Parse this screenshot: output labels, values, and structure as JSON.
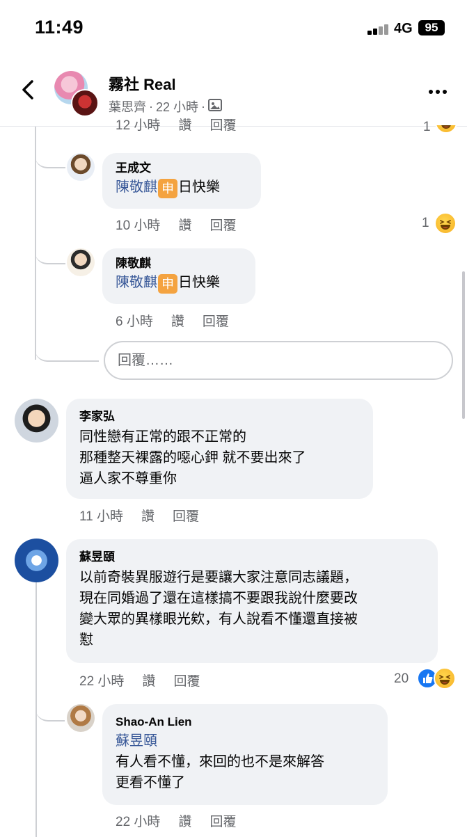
{
  "status_bar": {
    "time": "11:49",
    "network": "4G",
    "battery": "95"
  },
  "header": {
    "page_name": "霧社 Real",
    "author": "葉思齊",
    "separator": "·",
    "age": "22 小時",
    "separator2": "·"
  },
  "comments": [
    {
      "name": "",
      "clipped_actions": [
        "12 小時",
        "讚",
        "回覆"
      ],
      "reactions": "1"
    },
    {
      "name": "王成文",
      "mention": "陳敬麒",
      "badge": "申",
      "text": "日快樂",
      "time": "10 小時",
      "like": "讚",
      "reply": "回覆",
      "reactions": "1"
    },
    {
      "name": "陳敬麒",
      "mention": "陳敬麒",
      "badge": "申",
      "text": "日快樂",
      "time": "6 小時",
      "like": "讚",
      "reply": "回覆"
    },
    {
      "name": "李家弘",
      "text": "同性戀有正常的跟不正常的\n那種整天裸露的噁心鉀 就不要出來了\n逼人家不尊重你",
      "time": "11 小時",
      "like": "讚",
      "reply": "回覆"
    },
    {
      "name": "蘇昱頤",
      "text": "以前奇裝異服遊行是要讓大家注意同志議題，\n現在同婚過了還在這樣搞不要跟我說什麼要改\n變大眾的異樣眼光欸，有人說看不懂還直接被\n懟",
      "time": "22 小時",
      "like": "讚",
      "reply": "回覆",
      "reactions": "20"
    },
    {
      "name": "Shao-An Lien",
      "mention": "蘇昱頤",
      "text": "有人看不懂，來回的也不是來解答\n更看不懂了",
      "time": "22 小時",
      "like": "讚",
      "reply": "回覆"
    }
  ],
  "reply_input": {
    "placeholder": "回覆……"
  },
  "colors": {
    "mention": "#385898",
    "bubble": "#f0f2f5",
    "meta": "#65676b",
    "badge": "#f4a340",
    "like": "#1877f2"
  },
  "icons": [
    "back-arrow-icon",
    "more-dots-icon",
    "photo-icon",
    "haha-emoji-icon",
    "like-reaction-icon"
  ]
}
